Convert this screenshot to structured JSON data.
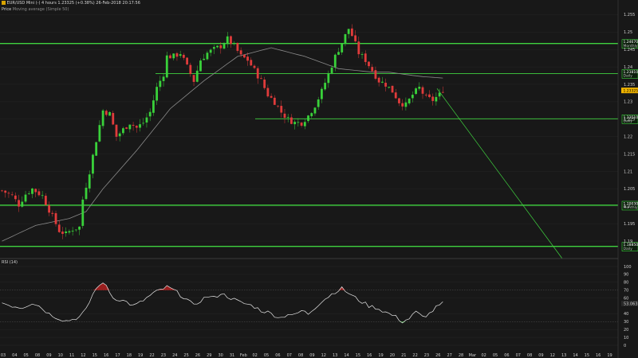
{
  "header": {
    "icon_name": "instrument-icon",
    "instrument": "EUR/USD Mini (-)",
    "timeframe": "4 hours",
    "last": "1.23325",
    "change": "(+0.38%)",
    "datetime": "26-Feb-2018 20:17:56",
    "price_label": "Price",
    "price_sublabel": "Moving average (Simple 50)"
  },
  "rsi_label": "RSI (14)",
  "colors": {
    "background": "#181818",
    "up": "#39d13a",
    "down": "#e03b3b",
    "level": "#3fd23f",
    "ma": "#8a8a8a",
    "rsi": "#e6e6e6",
    "overbought": "#b02020",
    "oversold": "#2eb02e",
    "current": "#f0b400"
  },
  "price_axis": {
    "ticks": [
      "1.255",
      "1.25",
      "1.245",
      "1.24",
      "1.235",
      "1.23",
      "1.225",
      "1.22",
      "1.215",
      "1.21",
      "1.205",
      "1.2",
      "1.195",
      "1.19"
    ]
  },
  "rsi_axis": {
    "ticks": [
      "100",
      "90",
      "80",
      "70",
      "60",
      "53.063",
      "40",
      "30",
      "20",
      "10",
      "0"
    ]
  },
  "levels": [
    {
      "price": "1.24670",
      "tag": "Monthly",
      "price_num": 1.2467
    },
    {
      "price": "1.23810",
      "tag": "Daily",
      "price_num": 1.2381
    },
    {
      "price": "1.22510",
      "tag": "Daily",
      "price_num": 1.2251
    },
    {
      "price": "1.20030",
      "tag": "Monthly",
      "price_num": 1.2003
    },
    {
      "price": "1.18850",
      "tag": "Daily",
      "price_num": 1.1885
    }
  ],
  "current_price": {
    "label": "1.23325",
    "value": 1.23325
  },
  "x_axis": {
    "labels": [
      "03",
      "04",
      "05",
      "08",
      "09",
      "10",
      "11",
      "12",
      "15",
      "16",
      "17",
      "18",
      "19",
      "22",
      "23",
      "24",
      "25",
      "26",
      "29",
      "30",
      "31",
      "Feb",
      "02",
      "05",
      "06",
      "07",
      "08",
      "09",
      "12",
      "13",
      "14",
      "15",
      "16",
      "19",
      "20",
      "21",
      "22",
      "23",
      "26",
      "27",
      "28",
      "Mar",
      "02",
      "05",
      "06",
      "07",
      "08",
      "09",
      "12",
      "13",
      "14",
      "15",
      "16",
      "19",
      "20"
    ]
  },
  "chart_data": {
    "type": "candlestick",
    "ylim": [
      1.185,
      1.256
    ],
    "rsi_ylim": [
      0,
      100
    ],
    "overbought": 70,
    "oversold": 30,
    "last_price": 1.23325,
    "last_rsi": 53.063,
    "close_path": [
      [
        0,
        1.2045
      ],
      [
        3,
        1.203
      ],
      [
        5,
        1.2005
      ],
      [
        7,
        1.2035
      ],
      [
        9,
        1.205
      ],
      [
        12,
        1.203
      ],
      [
        15,
        1.197
      ],
      [
        17,
        1.193
      ],
      [
        19,
        1.192
      ],
      [
        21,
        1.1935
      ],
      [
        23,
        1.194
      ],
      [
        24,
        1.202
      ],
      [
        26,
        1.21
      ],
      [
        28,
        1.219
      ],
      [
        30,
        1.2275
      ],
      [
        32,
        1.2265
      ],
      [
        34,
        1.22
      ],
      [
        36,
        1.222
      ],
      [
        38,
        1.224
      ],
      [
        40,
        1.2225
      ],
      [
        42,
        1.224
      ],
      [
        44,
        1.227
      ],
      [
        46,
        1.234
      ],
      [
        48,
        1.238
      ],
      [
        49,
        1.243
      ],
      [
        51,
        1.243
      ],
      [
        53,
        1.244
      ],
      [
        55,
        1.24
      ],
      [
        57,
        1.236
      ],
      [
        59,
        1.242
      ],
      [
        61,
        1.244
      ],
      [
        63,
        1.245
      ],
      [
        65,
        1.246
      ],
      [
        67,
        1.248
      ],
      [
        69,
        1.246
      ],
      [
        71,
        1.243
      ],
      [
        73,
        1.242
      ],
      [
        75,
        1.239
      ],
      [
        77,
        1.236
      ],
      [
        79,
        1.232
      ],
      [
        81,
        1.23
      ],
      [
        83,
        1.227
      ],
      [
        85,
        1.225
      ],
      [
        87,
        1.224
      ],
      [
        89,
        1.224
      ],
      [
        91,
        1.226
      ],
      [
        93,
        1.229
      ],
      [
        95,
        1.233
      ],
      [
        97,
        1.238
      ],
      [
        99,
        1.243
      ],
      [
        101,
        1.247
      ],
      [
        103,
        1.251
      ],
      [
        104,
        1.249
      ],
      [
        106,
        1.244
      ],
      [
        108,
        1.242
      ],
      [
        110,
        1.239
      ],
      [
        112,
        1.236
      ],
      [
        114,
        1.235
      ],
      [
        116,
        1.233
      ],
      [
        118,
        1.23
      ],
      [
        120,
        1.229
      ],
      [
        122,
        1.232
      ],
      [
        124,
        1.234
      ],
      [
        126,
        1.231
      ],
      [
        128,
        1.2305
      ],
      [
        130,
        1.232
      ],
      [
        131,
        1.2335
      ]
    ],
    "rsi_path": [
      [
        0,
        54
      ],
      [
        3,
        50
      ],
      [
        6,
        48
      ],
      [
        9,
        54
      ],
      [
        11,
        50
      ],
      [
        14,
        40
      ],
      [
        17,
        34
      ],
      [
        19,
        31
      ],
      [
        21,
        33
      ],
      [
        23,
        36
      ],
      [
        25,
        45
      ],
      [
        27,
        65
      ],
      [
        29,
        78
      ],
      [
        31,
        76
      ],
      [
        33,
        60
      ],
      [
        35,
        58
      ],
      [
        37,
        55
      ],
      [
        39,
        50
      ],
      [
        41,
        54
      ],
      [
        43,
        60
      ],
      [
        45,
        66
      ],
      [
        47,
        70
      ],
      [
        49,
        74
      ],
      [
        51,
        70
      ],
      [
        53,
        64
      ],
      [
        55,
        58
      ],
      [
        57,
        50
      ],
      [
        59,
        57
      ],
      [
        61,
        62
      ],
      [
        63,
        60
      ],
      [
        65,
        66
      ],
      [
        67,
        62
      ],
      [
        69,
        58
      ],
      [
        71,
        54
      ],
      [
        73,
        52
      ],
      [
        75,
        49
      ],
      [
        77,
        44
      ],
      [
        79,
        42
      ],
      [
        81,
        38
      ],
      [
        83,
        35
      ],
      [
        85,
        40
      ],
      [
        87,
        38
      ],
      [
        89,
        44
      ],
      [
        91,
        40
      ],
      [
        93,
        48
      ],
      [
        95,
        56
      ],
      [
        97,
        62
      ],
      [
        99,
        68
      ],
      [
        101,
        72
      ],
      [
        103,
        66
      ],
      [
        105,
        60
      ],
      [
        107,
        55
      ],
      [
        109,
        50
      ],
      [
        111,
        48
      ],
      [
        113,
        44
      ],
      [
        115,
        40
      ],
      [
        117,
        36
      ],
      [
        119,
        30
      ],
      [
        121,
        34
      ],
      [
        123,
        42
      ],
      [
        125,
        36
      ],
      [
        127,
        40
      ],
      [
        129,
        48
      ],
      [
        131,
        53
      ]
    ],
    "ma_path": [
      [
        0,
        1.19
      ],
      [
        10,
        1.1945
      ],
      [
        20,
        1.1965
      ],
      [
        25,
        1.1985
      ],
      [
        30,
        1.205
      ],
      [
        40,
        1.216
      ],
      [
        50,
        1.228
      ],
      [
        60,
        1.236
      ],
      [
        70,
        1.243
      ],
      [
        80,
        1.2455
      ],
      [
        90,
        1.243
      ],
      [
        100,
        1.2395
      ],
      [
        110,
        1.2385
      ],
      [
        115,
        1.2385
      ],
      [
        120,
        1.2378
      ],
      [
        125,
        1.2372
      ],
      [
        131,
        1.2368
      ]
    ]
  }
}
